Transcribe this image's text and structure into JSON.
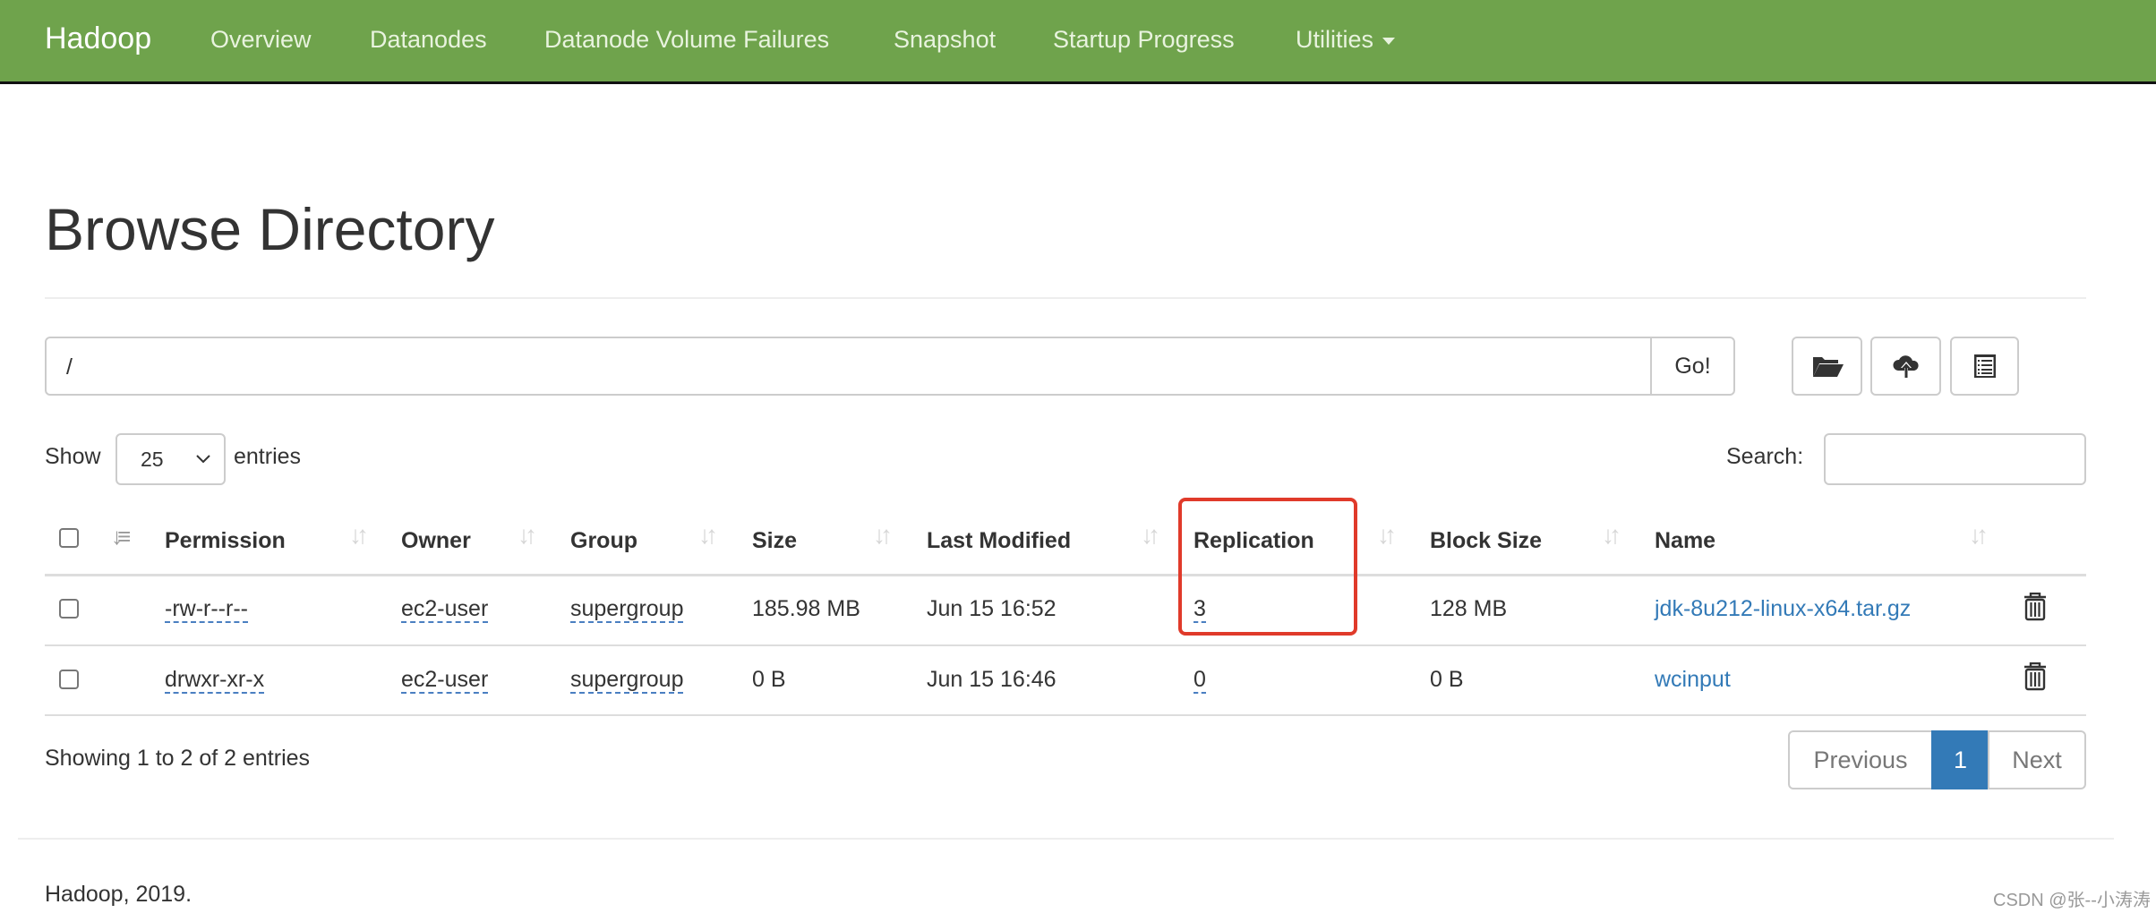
{
  "navbar": {
    "brand": "Hadoop",
    "items": [
      "Overview",
      "Datanodes",
      "Datanode Volume Failures",
      "Snapshot",
      "Startup Progress",
      "Utilities"
    ],
    "color": "#6fa34c"
  },
  "page_title": "Browse Directory",
  "path": {
    "value": "/",
    "go_label": "Go!"
  },
  "toolbar": {
    "icons": [
      "folder-open-icon",
      "cloud-upload-icon",
      "list-alt-icon"
    ]
  },
  "length": {
    "show_label": "Show",
    "value": "25",
    "entries_label": "entries"
  },
  "search": {
    "label": "Search:",
    "value": ""
  },
  "table": {
    "headers": [
      "Permission",
      "Owner",
      "Group",
      "Size",
      "Last Modified",
      "Replication",
      "Block Size",
      "Name"
    ],
    "rows": [
      {
        "permission": "-rw-r--r--",
        "owner": "ec2-user",
        "group": "supergroup",
        "size": "185.98 MB",
        "modified": "Jun 15 16:52",
        "replication": "3",
        "block_size": "128 MB",
        "name": "jdk-8u212-linux-x64.tar.gz"
      },
      {
        "permission": "drwxr-xr-x",
        "owner": "ec2-user",
        "group": "supergroup",
        "size": "0 B",
        "modified": "Jun 15 16:46",
        "replication": "0",
        "block_size": "0 B",
        "name": "wcinput"
      }
    ]
  },
  "info": "Showing 1 to 2 of 2 entries",
  "pagination": {
    "previous": "Previous",
    "current": "1",
    "next": "Next",
    "active_color": "#337ab7"
  },
  "highlight_color": "#e03a2a",
  "footer": "Hadoop, 2019.",
  "watermark": "CSDN @张--小涛涛"
}
